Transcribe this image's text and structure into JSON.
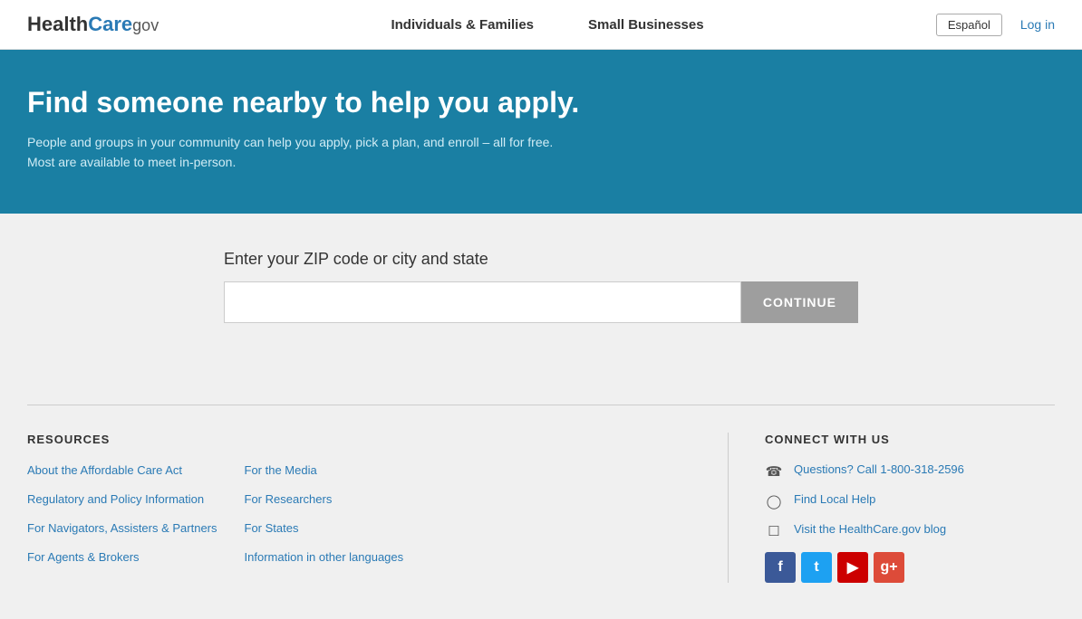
{
  "header": {
    "logo_health": "Health",
    "logo_care": "Care",
    "logo_dot": ".",
    "logo_gov": "gov",
    "nav": {
      "individuals": "Individuals & Families",
      "small_businesses": "Small Businesses"
    },
    "espanol": "Español",
    "login": "Log in"
  },
  "hero": {
    "title": "Find someone nearby to help you apply.",
    "subtitle": "People and groups in your community can help you apply, pick a plan, and enroll – all for free. Most are available to meet in-person."
  },
  "search": {
    "label": "Enter your ZIP code or city and state",
    "placeholder": "",
    "continue_btn": "CONTINUE"
  },
  "resources": {
    "heading": "RESOURCES",
    "col1": [
      "About the Affordable Care Act",
      "Regulatory and Policy Information",
      "For Navigators, Assisters & Partners",
      "For Agents & Brokers"
    ],
    "col2": [
      "For the Media",
      "For Researchers",
      "For States",
      "Information in other languages"
    ]
  },
  "connect": {
    "heading": "CONNECT WITH US",
    "items": [
      {
        "icon": "phone",
        "text": "Questions? Call 1-800-318-2596"
      },
      {
        "icon": "person",
        "text": "Find Local Help"
      },
      {
        "icon": "chat",
        "text": "Visit the HealthCare.gov blog"
      }
    ],
    "social": [
      {
        "name": "facebook",
        "label": "f",
        "color": "fb"
      },
      {
        "name": "twitter",
        "label": "t",
        "color": "tw"
      },
      {
        "name": "youtube",
        "label": "▶",
        "color": "yt"
      },
      {
        "name": "googleplus",
        "label": "g+",
        "color": "gp"
      }
    ]
  }
}
